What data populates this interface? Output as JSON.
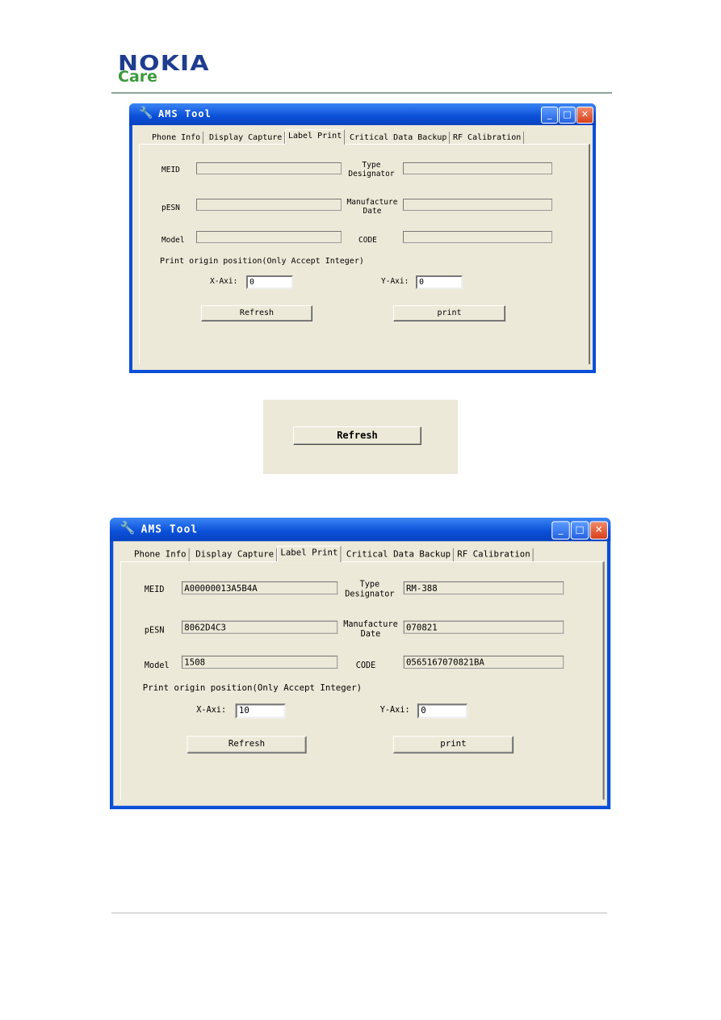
{
  "logo": {
    "brand": "NOKIA",
    "sub": "Care"
  },
  "zoomed_button": {
    "label": "Refresh"
  },
  "window1": {
    "title": "AMS Tool",
    "tabs": [
      "Phone Info",
      "Display Capture",
      "Label Print",
      "Critical Data Backup",
      "RF Calibration"
    ],
    "selected_tab": "Label Print",
    "labels": {
      "meid": "MEID",
      "type1": "Type",
      "type2": "Designator",
      "pesn": "pESN",
      "mfg1": "Manufacture",
      "mfg2": "Date",
      "model": "Model",
      "code": "CODE"
    },
    "values": {
      "meid": "",
      "type": "",
      "pesn": "",
      "mfg": "",
      "model": "",
      "code": ""
    },
    "origin_label": "Print origin position(Only Accept Integer)",
    "x_label": "X-Axi:",
    "x_value": "0",
    "y_label": "Y-Axi:",
    "y_value": "0",
    "refresh": "Refresh",
    "print": "print"
  },
  "window2": {
    "title": "AMS Tool",
    "tabs": [
      "Phone Info",
      "Display Capture",
      "Label Print",
      "Critical Data Backup",
      "RF Calibration"
    ],
    "selected_tab": "Label Print",
    "labels": {
      "meid": "MEID",
      "type1": "Type",
      "type2": "Designator",
      "pesn": "pESN",
      "mfg1": "Manufacture",
      "mfg2": "Date",
      "model": "Model",
      "code": "CODE"
    },
    "values": {
      "meid": "A00000013A5B4A",
      "type": "RM-388",
      "pesn": "8062D4C3",
      "mfg": "070821",
      "model": "1508",
      "code": "0565167070821BA"
    },
    "origin_label": "Print origin position(Only Accept Integer)",
    "x_label": "X-Axi:",
    "x_value": "10",
    "y_label": "Y-Axi:",
    "y_value": "0",
    "refresh": "Refresh",
    "print": "print"
  }
}
